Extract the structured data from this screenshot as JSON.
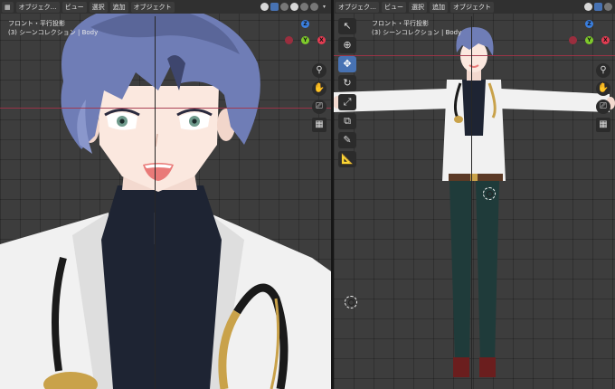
{
  "left_viewport": {
    "header": {
      "mode_label": "オブジェク…",
      "menu": [
        "ビュー",
        "選択",
        "追加",
        "オブジェクト"
      ]
    },
    "view_title": "フロント・平行投影",
    "collection_label": "(3) シーンコレクション | Body"
  },
  "right_viewport": {
    "header": {
      "mode_label": "オブジェク…",
      "menu": [
        "ビュー",
        "選択",
        "追加",
        "オブジェクト"
      ]
    },
    "view_title": "フロント・平行投影",
    "collection_label": "(3) シーンコレクション | Body"
  },
  "gizmo": {
    "z_label": "Z",
    "y_label": "Y",
    "x_label": "X"
  },
  "nav_icons": [
    "zoom-icon",
    "hand-pan-icon",
    "camera-icon",
    "grid-icon"
  ],
  "tools": [
    "cursor-select-icon",
    "3d-cursor-icon",
    "move-icon",
    "rotate-icon",
    "scale-icon",
    "transform-icon",
    "annotate-icon",
    "measure-icon"
  ],
  "colors": {
    "viewport_bg": "#3d3d3d",
    "header_bg": "#303030",
    "x_axis": "#a33248",
    "active_tool": "#4772b3",
    "gizmo_x": "#e43c52",
    "gizmo_y": "#7ec92b",
    "gizmo_z": "#3a7fe0"
  }
}
